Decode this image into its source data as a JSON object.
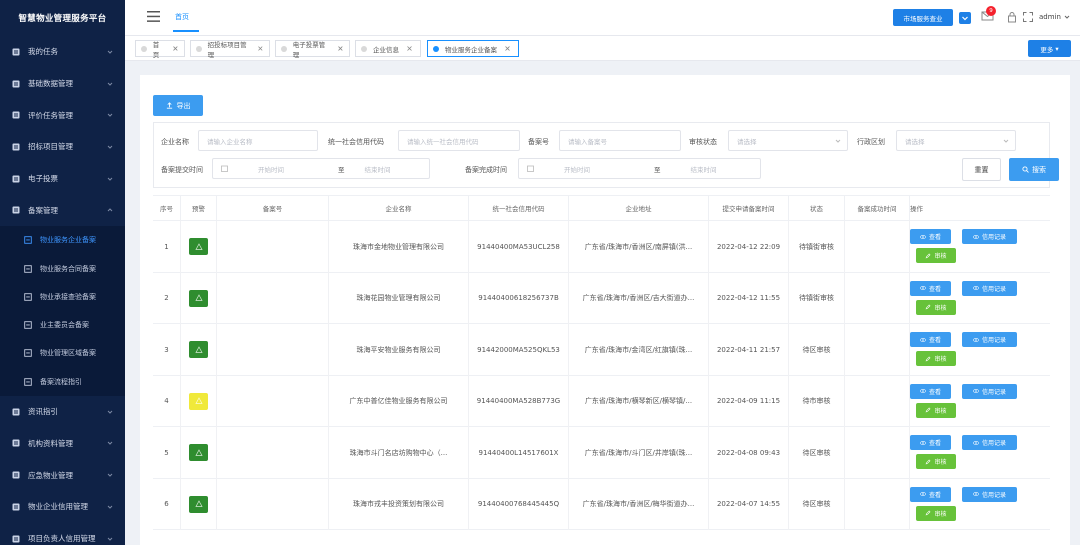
{
  "app": {
    "title": "智慧物业管理服务平台"
  },
  "topbar": {
    "nav_home": "首页",
    "primary_button": "市场服务查业",
    "notification_count": "9",
    "username": "admin"
  },
  "sidebar": {
    "items": [
      {
        "label": "我的任务"
      },
      {
        "label": "基础数据管理"
      },
      {
        "label": "评价任务管理"
      },
      {
        "label": "招标项目管理"
      },
      {
        "label": "电子投票"
      },
      {
        "label": "备案管理"
      }
    ],
    "sub_items": [
      {
        "label": "物业服务企业备案"
      },
      {
        "label": "物业服务合同备案"
      },
      {
        "label": "物业承接查验备案"
      },
      {
        "label": "业主委员会备案"
      },
      {
        "label": "物业管理区域备案"
      },
      {
        "label": "备案流程指引"
      }
    ],
    "items_after": [
      {
        "label": "资讯指引"
      },
      {
        "label": "机构资料管理"
      },
      {
        "label": "应急物业管理"
      },
      {
        "label": "物业企业信用管理"
      },
      {
        "label": "项目负责人信用管理"
      }
    ]
  },
  "tabs": [
    {
      "label": "首页"
    },
    {
      "label": "招投标项目管理"
    },
    {
      "label": "电子投票管理"
    },
    {
      "label": "企业信息"
    },
    {
      "label": "物业服务企业备案"
    }
  ],
  "tabs_more": "更多",
  "toolbar": {
    "export_label": "导出"
  },
  "filters": {
    "company_name_label": "企业名称",
    "company_name_placeholder": "请输入企业名称",
    "credit_code_label": "统一社会信用代码",
    "credit_code_placeholder": "请输入统一社会信用代码",
    "record_no_label": "备案号",
    "record_no_placeholder": "请输入备案号",
    "audit_status_label": "审核状态",
    "audit_status_placeholder": "请选择",
    "district_label": "行政区划",
    "district_placeholder": "请选择",
    "submit_time_label": "备案提交时间",
    "start_placeholder": "开始时间",
    "to": "至",
    "end_placeholder": "结束时间",
    "complete_time_label": "备案完成时间",
    "start_placeholder2": "开始时间",
    "to2": "至",
    "end_placeholder2": "结束时间",
    "reset_label": "重置",
    "search_label": "搜索"
  },
  "table": {
    "headers": [
      "序号",
      "预警",
      "备案号",
      "企业名称",
      "统一社会信用代码",
      "企业地址",
      "提交申请备案时间",
      "状态",
      "备案成功时间",
      "操作"
    ],
    "view_label": "查看",
    "credit_label": "信用记录",
    "review_label": "审核",
    "rows": [
      {
        "no": "1",
        "warning_color": "#2f8d2f",
        "record_no": "",
        "company": "珠海市金地物业管理有限公司",
        "credit_code": "91440400MA53UCL258",
        "address": "广东省/珠海市/香洲区/南屏镇(洪...",
        "submit_time": "2022-04-12 22:09",
        "status": "待镇街审核",
        "success_time": ""
      },
      {
        "no": "2",
        "warning_color": "#2f8d2f",
        "record_no": "",
        "company": "珠海花园物业管理有限公司",
        "credit_code": "91440400618256737B",
        "address": "广东省/珠海市/香洲区/吉大街道办...",
        "submit_time": "2022-04-12 11:55",
        "status": "待镇街审核",
        "success_time": ""
      },
      {
        "no": "3",
        "warning_color": "#2f8d2f",
        "record_no": "",
        "company": "珠海平安物业服务有限公司",
        "credit_code": "91442000MA525QKL53",
        "address": "广东省/珠海市/金湾区/红旗镇(珠...",
        "submit_time": "2022-04-11 21:57",
        "status": "待区审核",
        "success_time": ""
      },
      {
        "no": "4",
        "warning_color": "#f0e93a",
        "record_no": "",
        "company": "广东中普亿佳物业服务有限公司",
        "credit_code": "91440400MA528B773G",
        "address": "广东省/珠海市/横琴新区/横琴镇/...",
        "submit_time": "2022-04-09 11:15",
        "status": "待市审核",
        "success_time": ""
      },
      {
        "no": "5",
        "warning_color": "#2f8d2f",
        "record_no": "",
        "company": "珠海市斗门名店坊购物中心（...",
        "credit_code": "91440400L14517601X",
        "address": "广东省/珠海市/斗门区/井岸镇(珠...",
        "submit_time": "2022-04-08 09:43",
        "status": "待区审核",
        "success_time": ""
      },
      {
        "no": "6",
        "warning_color": "#2f8d2f",
        "record_no": "",
        "company": "珠海市戎丰投资策划有限公司",
        "credit_code": "91440400768445445Q",
        "address": "广东省/珠海市/香洲区/梅华街道办...",
        "submit_time": "2022-04-07 14:55",
        "status": "待区审核",
        "success_time": ""
      }
    ]
  }
}
